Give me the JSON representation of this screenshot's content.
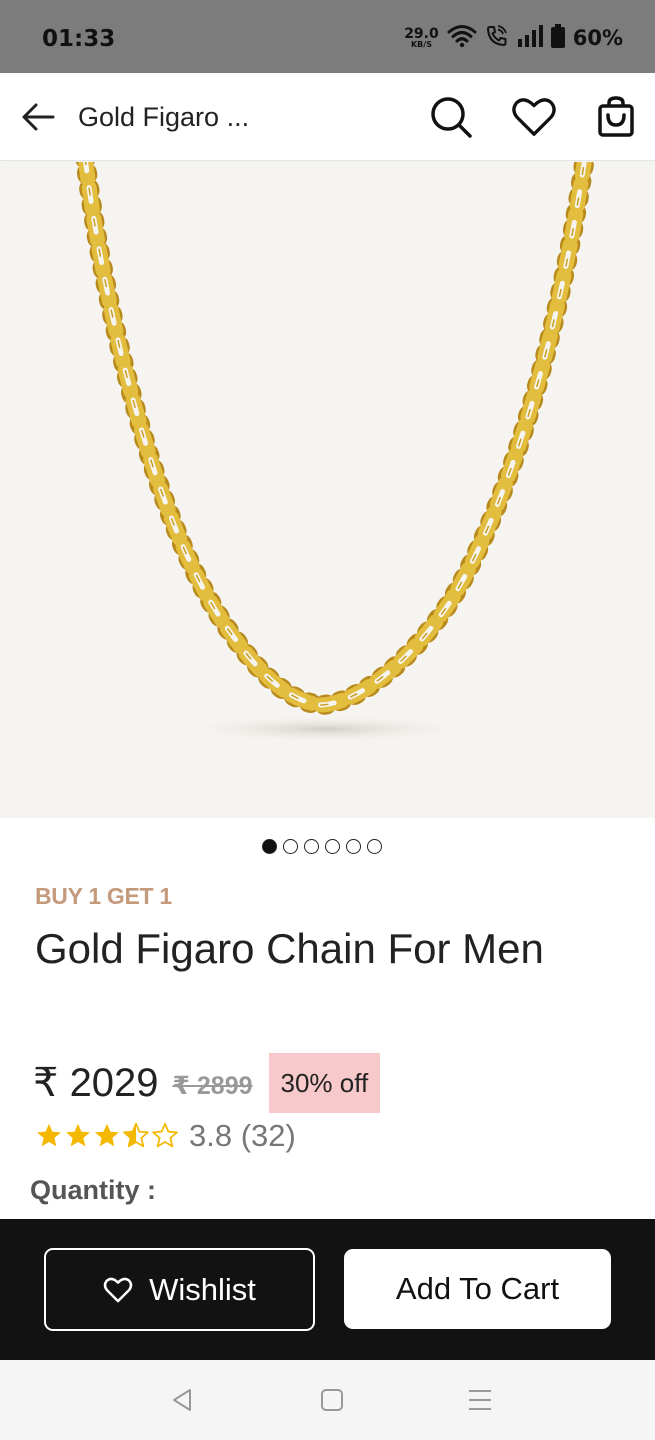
{
  "status_bar": {
    "time": "01:33",
    "net_speed_value": "29.0",
    "net_speed_unit": "KB/S",
    "battery": "60%"
  },
  "header": {
    "title": "Gold Figaro ..."
  },
  "gallery": {
    "image_count": 6,
    "active_index": 0
  },
  "product": {
    "promo": "BUY 1 GET 1",
    "title": "Gold Figaro Chain For Men",
    "price": "₹ 2029",
    "mrp": "₹ 2899",
    "discount": "30% off",
    "rating_stars": 3.5,
    "rating": "3.8 (32)",
    "quantity_label": "Quantity :"
  },
  "actions": {
    "wishlist_label": "Wishlist",
    "cart_label": "Add To Cart"
  },
  "colors": {
    "promo": "#c49a7c",
    "star": "#f5b800",
    "discount_bg": "#f7c9cb",
    "bottom_bar": "#121212",
    "gold": "#d4a92a"
  }
}
